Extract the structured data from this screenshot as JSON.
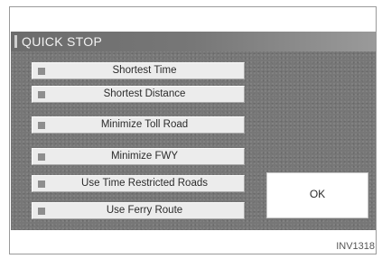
{
  "dialog": {
    "title": "QUICK STOP",
    "options": [
      {
        "label": "Shortest Time"
      },
      {
        "label": "Shortest Distance"
      },
      {
        "label": "Minimize Toll Road"
      },
      {
        "label": "Minimize FWY"
      },
      {
        "label": "Use Time Restricted Roads"
      },
      {
        "label": "Use Ferry Route"
      }
    ],
    "ok_label": "OK"
  },
  "figure_code": "INV1318",
  "colors": {
    "screen_bg": "#777777",
    "option_bg": "#ececec",
    "checkbox": "#8e8e8e",
    "title_text": "#f2f2f2"
  }
}
